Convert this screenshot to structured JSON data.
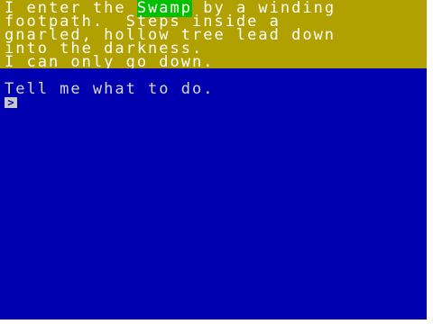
{
  "description": {
    "line1_before": "I enter the ",
    "line1_highlight": "Swamp",
    "line1_after": " by a winding",
    "line2": "footpath.  Steps inside a",
    "line3": "gnarled, hollow tree lead down",
    "line4": "into the darkness.",
    "line5": "I can only go down."
  },
  "command": {
    "prompt_text": "Tell me what to do.",
    "cursor_glyph": ">"
  },
  "colors": {
    "description_background": "#b0a000",
    "command_background": "#0000b0",
    "highlight_background": "#00c000"
  }
}
